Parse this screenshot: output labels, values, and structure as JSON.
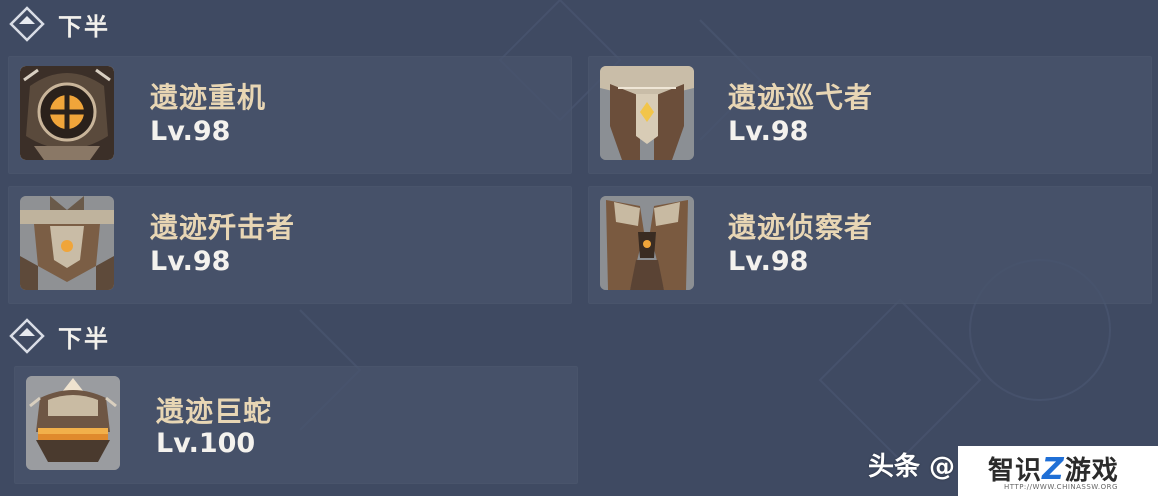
{
  "sections": [
    {
      "title": "下半"
    },
    {
      "title": "下半"
    }
  ],
  "enemies": [
    {
      "name": "遗迹重机",
      "level": "Lv.98",
      "icon": "ruin-grader-icon"
    },
    {
      "name": "遗迹巡弋者",
      "level": "Lv.98",
      "icon": "ruin-cruiser-icon"
    },
    {
      "name": "遗迹歼击者",
      "level": "Lv.98",
      "icon": "ruin-destroyer-icon"
    },
    {
      "name": "遗迹侦察者",
      "level": "Lv.98",
      "icon": "ruin-scout-icon"
    },
    {
      "name": "遗迹巨蛇",
      "level": "Lv.100",
      "icon": "ruin-serpent-icon"
    }
  ],
  "watermark": {
    "toutiao": "头条 @",
    "logo_prefix": "智识",
    "logo_z": "Z",
    "logo_suffix": "游戏",
    "url": "HTTP://WWW.CHINASSW.ORG"
  },
  "colors": {
    "background": "#3f4a62",
    "card": "#48536c",
    "name_gold": "#e8d6b4",
    "level_white": "#f4f2ee",
    "accent_orange": "#f0a53a"
  }
}
